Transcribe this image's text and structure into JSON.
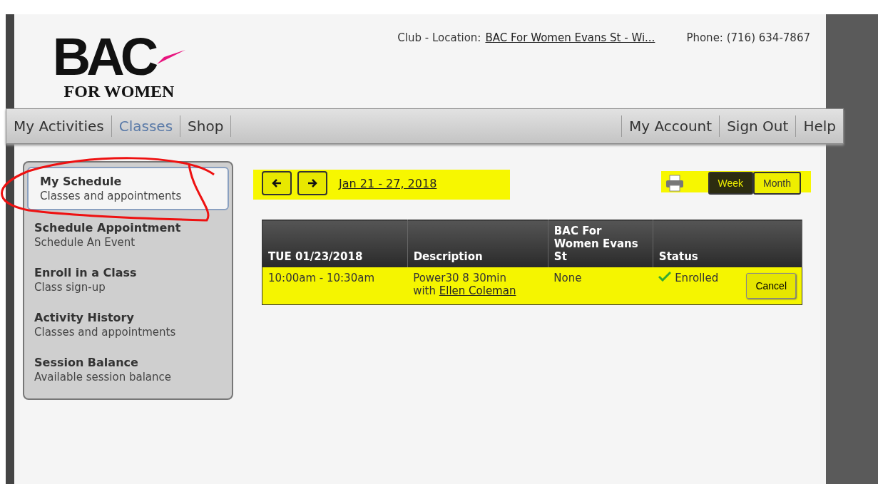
{
  "logo": {
    "title": "BAC",
    "subtitle": "FOR WOMEN"
  },
  "header": {
    "location_label": "Club - Location:",
    "location": "BAC For Women Evans St - Wi...",
    "phone": "Phone: (716) 634-7867"
  },
  "nav": {
    "left": [
      {
        "label": "My Activities",
        "selected": false
      },
      {
        "label": "Classes",
        "selected": true
      },
      {
        "label": "Shop",
        "selected": false
      }
    ],
    "right": [
      {
        "label": "My Account",
        "selected": false
      },
      {
        "label": "Sign Out",
        "selected": false
      },
      {
        "label": "Help",
        "selected": false
      }
    ]
  },
  "sidebar": {
    "items": [
      {
        "title": "My Schedule",
        "subtitle": "Classes and appointments",
        "selected": true
      },
      {
        "title": "Schedule Appointment",
        "subtitle": "Schedule An Event",
        "selected": false
      },
      {
        "title": "Enroll in a Class",
        "subtitle": "Class sign-up",
        "selected": false
      },
      {
        "title": "Activity History",
        "subtitle": "Classes and appointments",
        "selected": false
      },
      {
        "title": "Session Balance",
        "subtitle": "Available session balance",
        "selected": false
      }
    ]
  },
  "toolbar": {
    "range": "Jan 21 - 27, 2018",
    "views": [
      {
        "label": "Week",
        "selected": true
      },
      {
        "label": "Month",
        "selected": false
      }
    ]
  },
  "table": {
    "columns": [
      "TUE  01/23/2018",
      "Description",
      "BAC For Women Evans St",
      "Status"
    ],
    "rows": [
      {
        "time": "10:00am - 10:30am",
        "description": "Power30 8 30min",
        "with": "with",
        "instructor": "Ellen Coleman",
        "location": "None",
        "status": "Enrolled",
        "action": "Cancel"
      }
    ]
  }
}
